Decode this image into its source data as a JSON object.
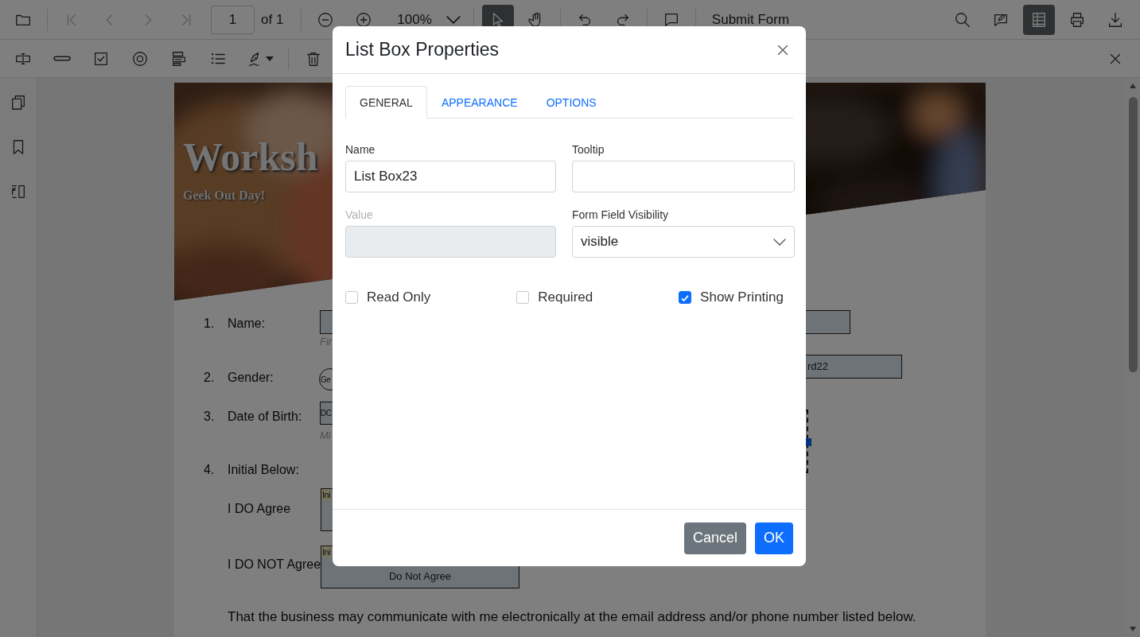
{
  "toolbar": {
    "open": {
      "kind": "open"
    },
    "navigation": [
      {
        "kind": "first",
        "disabled": true
      },
      {
        "kind": "previous",
        "disabled": true
      },
      {
        "kind": "next",
        "disabled": true
      },
      {
        "kind": "last",
        "disabled": true
      }
    ],
    "page_number": "1",
    "page_count": "of 1",
    "zoom_level": "100%",
    "modes": [
      {
        "kind": "select",
        "selected": true
      },
      {
        "kind": "pan",
        "selected": false
      }
    ],
    "history": [
      {
        "kind": "undo"
      },
      {
        "kind": "redo"
      }
    ],
    "comment": {
      "kind": "comment"
    },
    "submit_label": "Submit Form",
    "right_tools": [
      {
        "kind": "search",
        "selected": false
      },
      {
        "kind": "annotate",
        "selected": false
      },
      {
        "kind": "form-designer",
        "selected": true
      },
      {
        "kind": "print",
        "selected": false
      },
      {
        "kind": "download",
        "selected": false
      }
    ]
  },
  "form_toolbar": {
    "tools": [
      {
        "kind": "textbox"
      },
      {
        "kind": "password"
      },
      {
        "kind": "checkbox"
      },
      {
        "kind": "radio"
      },
      {
        "kind": "dropdown"
      },
      {
        "kind": "listbox"
      },
      {
        "kind": "signature"
      },
      {
        "kind": "delete"
      }
    ]
  },
  "sidebar": {
    "items": [
      {
        "kind": "thumbnails"
      },
      {
        "kind": "bookmarks"
      },
      {
        "kind": "organize"
      }
    ]
  },
  "document": {
    "title": "Worksh",
    "subtitle": "Geek Out Day!",
    "questions": [
      {
        "number": "1.",
        "label": "Name:"
      },
      {
        "number": "2.",
        "label": "Gender:"
      },
      {
        "number": "3.",
        "label": "Date of Birth:"
      },
      {
        "number": "4.",
        "label": "Initial Below:"
      }
    ],
    "agreements": [
      {
        "label": "I DO Agree"
      },
      {
        "label": "I DO NOT Agree"
      }
    ],
    "consent": "That the business may communicate with me electronically at the email address and/or phone number listed below.",
    "fields": [
      {
        "kind": "text-box"
      },
      {
        "kind": "hint",
        "text": "Fir"
      },
      {
        "kind": "radio",
        "text": "Ge"
      },
      {
        "kind": "text-box",
        "text": "rd22"
      },
      {
        "kind": "text-box",
        "text": "DC"
      },
      {
        "kind": "hint",
        "text": "Mi"
      },
      {
        "kind": "initial-box",
        "tag": "Ini"
      },
      {
        "kind": "initial-box",
        "tag": "Ini",
        "text": "Do Not Agree"
      },
      {
        "kind": "selection"
      }
    ]
  },
  "dialog": {
    "title": "List Box Properties",
    "tabs": [
      {
        "label": "GENERAL",
        "selected": true
      },
      {
        "label": "APPEARANCE",
        "selected": false
      },
      {
        "label": "OPTIONS",
        "selected": false
      }
    ],
    "fields": [
      {
        "label": "Name",
        "kind": "text",
        "value": "List Box23",
        "disabled": false
      },
      {
        "label": "Tooltip",
        "kind": "text",
        "disabled": false
      },
      {
        "label": "Value",
        "kind": "text",
        "disabled": true
      },
      {
        "label": "Form Field Visibility",
        "kind": "dropdown",
        "value": "visible",
        "disabled": false
      }
    ],
    "checkboxes": [
      {
        "label": "Read Only",
        "checked": false
      },
      {
        "label": "Required",
        "checked": false
      },
      {
        "label": "Show Printing",
        "checked": true
      }
    ],
    "buttons": [
      {
        "label": "Cancel",
        "kind": "secondary"
      },
      {
        "label": "OK",
        "kind": "primary"
      }
    ]
  }
}
